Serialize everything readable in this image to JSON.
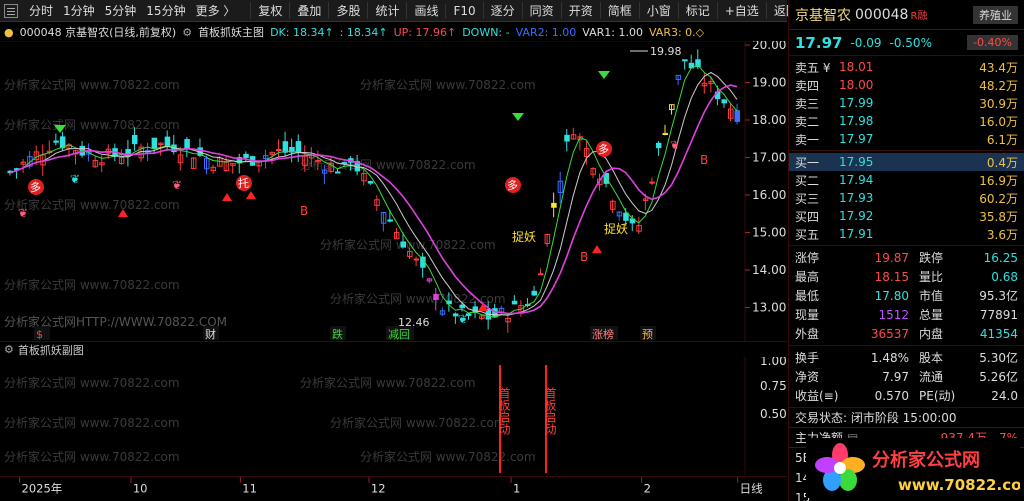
{
  "toolbar": {
    "items": [
      "分时",
      "1分钟",
      "5分钟",
      "15分钟",
      "更多 〉"
    ],
    "right_items": [
      "复权",
      "叠加",
      "多股",
      "统计",
      "画线",
      "F10",
      "逐分",
      "同资",
      "开资",
      "简框",
      "小窗",
      "标记",
      "+自选",
      "返回"
    ]
  },
  "chart_header": {
    "code_name": "000048 京基智农(日线,前复权)",
    "indicator": "首板抓妖主图",
    "dk": "DK: 18.34↑",
    "k2": ": 18.34↑",
    "up": "UP: 17.96↑",
    "down": "DOWN: -",
    "var2": "VAR2: 1.00",
    "var1": "VAR1: 1.00",
    "var3": "VAR3: 0.◇"
  },
  "sub_header": {
    "label": "首板抓妖副图"
  },
  "watermarks": [
    "分析家公式网HTTP://WWW.70822.COM",
    "分析家公式网 www.70822.com"
  ],
  "annotations": {
    "high_label": "19.98",
    "low_label": "12.46",
    "catch1": "捉妖",
    "catch2": "捉妖",
    "duo1": "多",
    "duo2": "多",
    "tuo": "托",
    "s_mark": "$",
    "b1": "B",
    "b2": "B",
    "b3": "B",
    "bottom_tags": [
      "$",
      "财",
      "跌",
      "减回",
      "涨榜",
      "预"
    ],
    "shouban": "首板启动"
  },
  "price_axis": [
    "20.00",
    "19.00",
    "18.00",
    "17.00",
    "16.00",
    "15.00",
    "14.00",
    "13.00"
  ],
  "sub_axis": [
    "1.00",
    "0.75",
    "0.50"
  ],
  "date_axis": [
    "2025年",
    "10",
    "11",
    "12",
    "1",
    "2",
    "日线"
  ],
  "panel": {
    "name": "京基智农",
    "code": "000048",
    "rz": "R融",
    "tag": "养殖业",
    "price": "17.97",
    "change": "-0.09",
    "pct": "-0.50%",
    "sector_pct": "-0.40%",
    "sells": [
      {
        "label": "卖五 ¥",
        "price": "18.01",
        "vol": "43.4万",
        "dir": "up"
      },
      {
        "label": "卖四",
        "price": "18.00",
        "vol": "48.2万",
        "dir": "up"
      },
      {
        "label": "卖三",
        "price": "17.99",
        "vol": "30.9万",
        "dir": "dn"
      },
      {
        "label": "卖二",
        "price": "17.98",
        "vol": "16.0万",
        "dir": "dn"
      },
      {
        "label": "卖一",
        "price": "17.97",
        "vol": "6.1万",
        "dir": "dn"
      }
    ],
    "buys": [
      {
        "label": "买一",
        "price": "17.95",
        "vol": "0.4万",
        "dir": "dn"
      },
      {
        "label": "买二",
        "price": "17.94",
        "vol": "16.9万",
        "dir": "dn"
      },
      {
        "label": "买三",
        "price": "17.93",
        "vol": "60.2万",
        "dir": "dn"
      },
      {
        "label": "买四",
        "price": "17.92",
        "vol": "35.8万",
        "dir": "dn"
      },
      {
        "label": "买五",
        "price": "17.91",
        "vol": "3.6万",
        "dir": "dn"
      }
    ],
    "stats": [
      {
        "k": "涨停",
        "v": "19.87",
        "vc": "up",
        "k2": "跌停",
        "v2": "16.25",
        "v2c": "dn"
      },
      {
        "k": "最高",
        "v": "18.15",
        "vc": "up",
        "k2": "量比",
        "v2": "0.68",
        "v2c": "dn"
      },
      {
        "k": "最低",
        "v": "17.80",
        "vc": "dn",
        "k2": "市值",
        "v2": "95.3亿",
        "v2c": "white"
      },
      {
        "k": "现量",
        "v": "1512",
        "vc": "purple",
        "k2": "总量",
        "v2": "77891",
        "v2c": "white"
      },
      {
        "k": "外盘",
        "v": "36537",
        "vc": "up",
        "k2": "内盘",
        "v2": "41354",
        "v2c": "dn"
      }
    ],
    "stats2": [
      {
        "k": "换手",
        "v": "1.48%",
        "vc": "white",
        "k2": "股本",
        "v2": "5.30亿",
        "v2c": "white"
      },
      {
        "k": "净资",
        "v": "7.97",
        "vc": "white",
        "k2": "流通",
        "v2": "5.26亿",
        "v2c": "white"
      },
      {
        "k": "收益(≡)",
        "v": "0.570",
        "vc": "white",
        "k2": "PE(动)",
        "v2": "24.0",
        "v2c": "white"
      }
    ],
    "trade_state": "交易状态: 闭市阶段 15:00:00",
    "main_flow_label": "主力净额",
    "main_flow_value": "937.4万",
    "main_flow_pct": "7%",
    "row_5e": "5E",
    "row_14": "14",
    "row_15": "15",
    "logo_text": "分析家公式网",
    "logo_url": "www.70822.com"
  }
}
